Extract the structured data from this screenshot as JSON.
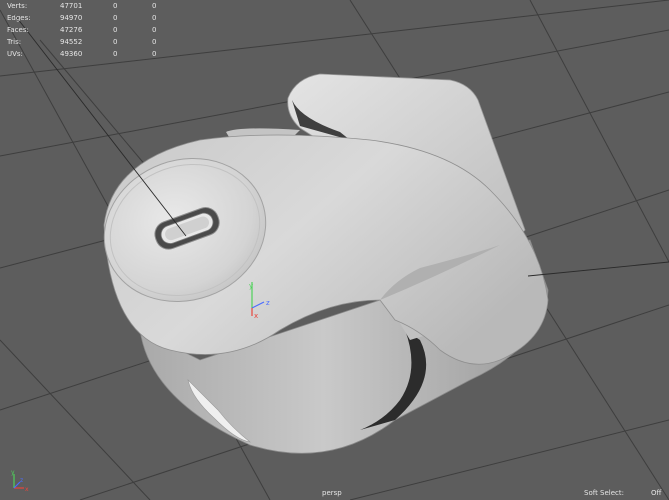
{
  "hud": {
    "rows": [
      {
        "label": "Verts:",
        "values": [
          "47701",
          "0",
          "0"
        ]
      },
      {
        "label": "Edges:",
        "values": [
          "94970",
          "0",
          "0"
        ]
      },
      {
        "label": "Faces:",
        "values": [
          "47276",
          "0",
          "0"
        ]
      },
      {
        "label": "Tris:",
        "values": [
          "94552",
          "0",
          "0"
        ]
      },
      {
        "label": "UVs:",
        "values": [
          "49360",
          "0",
          "0"
        ]
      }
    ]
  },
  "viewport": {
    "camera": "persp",
    "soft_select_label": "Soft Select:",
    "soft_select_value": "Off"
  },
  "axes": {
    "x_label": "x",
    "y_label": "y",
    "z_label": "z",
    "x_color": "#e8453c",
    "y_color": "#4fd15a",
    "z_color": "#4a6cff"
  },
  "colors": {
    "background": "#5d5d5d",
    "grid": "#3e3e3e",
    "model": "#d9d9d9"
  }
}
